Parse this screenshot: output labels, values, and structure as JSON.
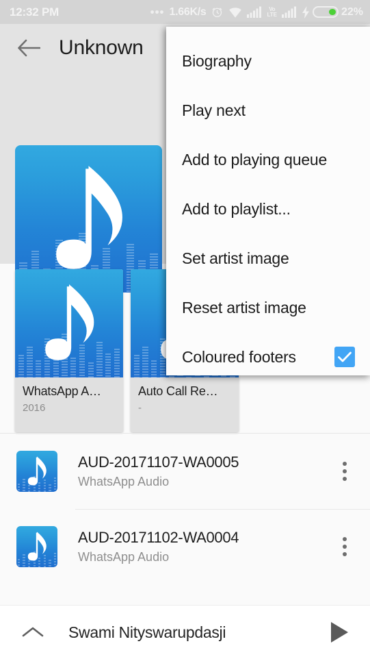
{
  "status_bar": {
    "time": "12:32 PM",
    "ellipsis": "•••",
    "network_speed": "1.66K/s",
    "alarm_icon": "alarm-clock-icon",
    "wifi_icon": "wifi-icon",
    "signal_icon_1": "signal-bars-icon",
    "volte_line1": "Vo",
    "volte_line2": "LTE",
    "signal_icon_2": "signal-bars-icon",
    "charging_icon": "lightning-bolt-icon",
    "battery_percent": "22%",
    "battery_color": "#4cd137"
  },
  "toolbar": {
    "back_icon": "back-arrow-icon",
    "title": "Unknown"
  },
  "hero": {
    "art_icon": "music-note-icon",
    "art_gradient_top": "#32a9e0",
    "art_gradient_bottom": "#1f6ece"
  },
  "albums": [
    {
      "title": "WhatsApp A…",
      "year": "2016",
      "art_icon": "music-note-icon"
    },
    {
      "title": "Auto Call Re…",
      "year": "-",
      "art_icon": "music-note-icon"
    }
  ],
  "songs": [
    {
      "title": "AUD-20171107-WA0005",
      "subtitle": "WhatsApp Audio",
      "art_icon": "music-note-icon",
      "overflow_icon": "kebab-menu-icon"
    },
    {
      "title": "AUD-20171102-WA0004",
      "subtitle": "WhatsApp Audio",
      "art_icon": "music-note-icon",
      "overflow_icon": "kebab-menu-icon"
    }
  ],
  "mini_player": {
    "expand_icon": "chevron-up-icon",
    "title": "Swami Nityswarupdasji",
    "play_icon": "play-icon"
  },
  "popup_menu": {
    "items": [
      {
        "label": "Biography",
        "type": "item"
      },
      {
        "label": "Play next",
        "type": "item"
      },
      {
        "label": "Add to playing queue",
        "type": "item"
      },
      {
        "label": "Add to playlist...",
        "type": "item"
      },
      {
        "label": "Set artist image",
        "type": "item"
      },
      {
        "label": "Reset artist image",
        "type": "item"
      },
      {
        "label": "Coloured footers",
        "type": "checkbox",
        "checked": true
      }
    ],
    "checkbox_color": "#42a5f5",
    "check_icon": "checkmark-icon"
  }
}
